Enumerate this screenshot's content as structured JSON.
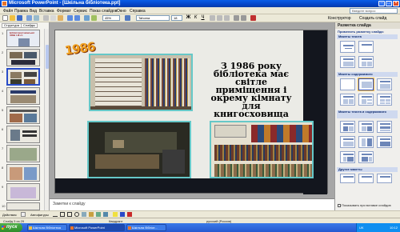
{
  "window": {
    "title": "Microsoft PowerPoint - [Шкільна бібліотека.ppt]"
  },
  "menu": {
    "items": [
      "Файл",
      "Правка",
      "Вид",
      "Вставка",
      "Формат",
      "Сервис",
      "Показ слайдов",
      "Окно",
      "Справка"
    ],
    "help_placeholder": "Введите вопрос"
  },
  "toolbar": {
    "zoom": "45%",
    "font": "Tahoma",
    "font_size": "18",
    "constructor_label": "Конструктор",
    "new_slide_label": "Создать слайд"
  },
  "left_pane": {
    "tabs": [
      "Структура",
      "Слайды"
    ],
    "slide_numbers": [
      "1",
      "2",
      "3",
      "4",
      "5",
      "6",
      "7",
      "8",
      "9",
      "10"
    ],
    "first_slide_caption": "Бібліотека Ізюмської ЗОШ І-ІІІ ст."
  },
  "slide": {
    "logo_text": "1986",
    "heading_lines": [
      "З 1986 року",
      "бібліотека має",
      "світле",
      "приміщення  і",
      "окрему кімнату",
      "для",
      "книгосховища"
    ]
  },
  "notes": {
    "placeholder": "Заметки к слайду"
  },
  "task_pane": {
    "title": "Разметка слайда",
    "apply_label": "Применить разметку слайда:",
    "sections": [
      "Макеты текста",
      "Макеты содержимого",
      "Макеты текста и содержимого",
      "Другие макеты"
    ],
    "show_when_inserting": "Показывать при вставке слайдов"
  },
  "drawing_toolbar": {
    "actions_label": "Действия",
    "autoshapes_label": "Автофигуры"
  },
  "status": {
    "slide": "Слайд 3 из 29",
    "design": "Квадрант",
    "language": "русский (Россия)"
  },
  "taskbar": {
    "start_label": "пуск",
    "tasks": [
      "Шкільна бібліотека",
      "Microsoft PowerPoint",
      "Шкільна бібліот..."
    ],
    "language": "UK",
    "clock": "10:12"
  },
  "colors": {
    "title_bar": "#0546c8",
    "photo_border": "#66c8c8",
    "logo": "#f0a020",
    "start": "#2e8c2a"
  }
}
